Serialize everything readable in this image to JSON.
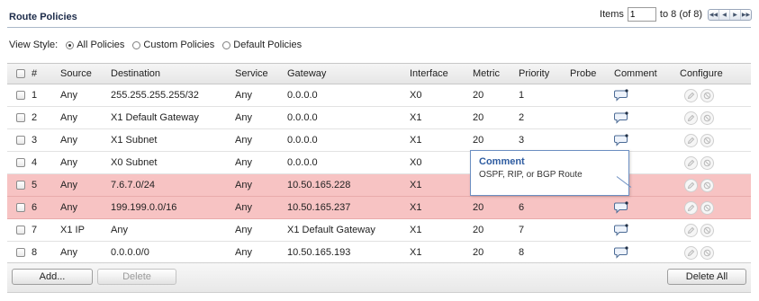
{
  "page_title": "Route Policies",
  "pagination": {
    "items_label": "Items",
    "items_value": "1",
    "range_text": "to 8 (of 8)"
  },
  "view_style": {
    "label": "View Style:",
    "options": [
      "All Policies",
      "Custom Policies",
      "Default Policies"
    ],
    "selected": "All Policies"
  },
  "table": {
    "headers": {
      "num": "#",
      "source": "Source",
      "destination": "Destination",
      "service": "Service",
      "gateway": "Gateway",
      "interface": "Interface",
      "metric": "Metric",
      "priority": "Priority",
      "probe": "Probe",
      "comment": "Comment",
      "configure": "Configure"
    },
    "rows": [
      {
        "num": "1",
        "source": "Any",
        "destination": "255.255.255.255/32",
        "service": "Any",
        "gateway": "0.0.0.0",
        "interface": "X0",
        "metric": "20",
        "priority": "1",
        "probe": "",
        "highlighted": false
      },
      {
        "num": "2",
        "source": "Any",
        "destination": "X1 Default Gateway",
        "service": "Any",
        "gateway": "0.0.0.0",
        "interface": "X1",
        "metric": "20",
        "priority": "2",
        "probe": "",
        "highlighted": false
      },
      {
        "num": "3",
        "source": "Any",
        "destination": "X1 Subnet",
        "service": "Any",
        "gateway": "0.0.0.0",
        "interface": "X1",
        "metric": "20",
        "priority": "3",
        "probe": "",
        "highlighted": false
      },
      {
        "num": "4",
        "source": "Any",
        "destination": "X0 Subnet",
        "service": "Any",
        "gateway": "0.0.0.0",
        "interface": "X0",
        "metric": "",
        "priority": "",
        "probe": "",
        "highlighted": false
      },
      {
        "num": "5",
        "source": "Any",
        "destination": "7.6.7.0/24",
        "service": "Any",
        "gateway": "10.50.165.228",
        "interface": "X1",
        "metric": "",
        "priority": "",
        "probe": "",
        "highlighted": true
      },
      {
        "num": "6",
        "source": "Any",
        "destination": "199.199.0.0/16",
        "service": "Any",
        "gateway": "10.50.165.237",
        "interface": "X1",
        "metric": "20",
        "priority": "6",
        "probe": "",
        "highlighted": true
      },
      {
        "num": "7",
        "source": "X1 IP",
        "destination": "Any",
        "service": "Any",
        "gateway": "X1 Default Gateway",
        "interface": "X1",
        "metric": "20",
        "priority": "7",
        "probe": "",
        "highlighted": false
      },
      {
        "num": "8",
        "source": "Any",
        "destination": "0.0.0.0/0",
        "service": "Any",
        "gateway": "10.50.165.193",
        "interface": "X1",
        "metric": "20",
        "priority": "8",
        "probe": "",
        "highlighted": false
      }
    ]
  },
  "tooltip": {
    "title": "Comment",
    "body": "OSPF, RIP, or BGP Route"
  },
  "buttons": {
    "add": "Add...",
    "delete": "Delete",
    "delete_all": "Delete All"
  },
  "colors": {
    "highlight_row": "#f7c3c3",
    "tooltip_border": "#6c8fc2",
    "title_text": "#1d2c4a"
  },
  "icons": {
    "comment": "comment-bubble-icon",
    "edit": "edit-pencil-icon",
    "delete": "delete-circle-icon"
  }
}
